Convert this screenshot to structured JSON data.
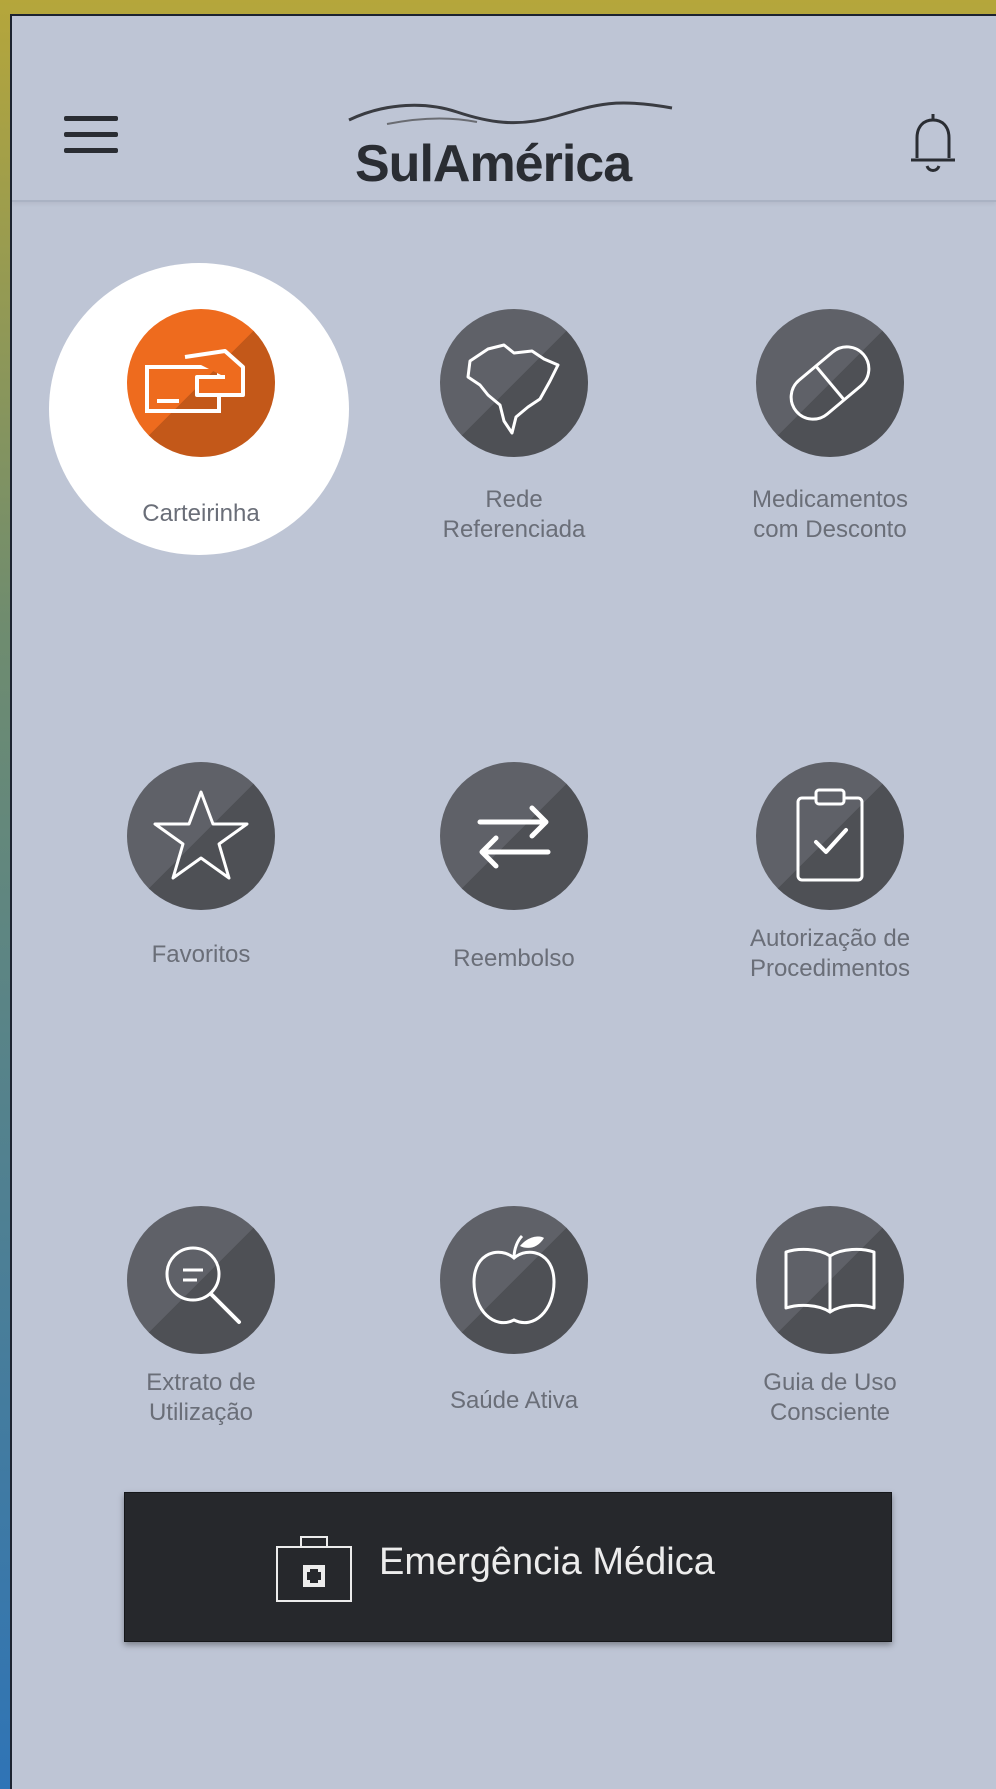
{
  "header": {
    "brand": "SulAmérica",
    "menu_icon": "hamburger-menu-icon",
    "bell_icon": "bell-icon"
  },
  "tiles": [
    {
      "label": "Carteirinha",
      "icon": "id-card-icon",
      "highlighted": true
    },
    {
      "label": "Rede\nReferenciada",
      "icon": "brazil-map-icon"
    },
    {
      "label": "Medicamentos\ncom Desconto",
      "icon": "pill-icon"
    },
    {
      "label": "Favoritos",
      "icon": "star-icon"
    },
    {
      "label": "Reembolso",
      "icon": "transfer-arrows-icon"
    },
    {
      "label": "Autorização de\nProcedimentos",
      "icon": "clipboard-check-icon"
    },
    {
      "label": "Extrato de\nUtilização",
      "icon": "magnifier-icon"
    },
    {
      "label": "Saúde Ativa",
      "icon": "apple-icon"
    },
    {
      "label": "Guia de Uso\nConsciente",
      "icon": "open-book-icon"
    }
  ],
  "emergency": {
    "label": "Emergência Médica",
    "icon": "first-aid-kit-icon"
  },
  "colors": {
    "background": "#bec5d5",
    "accent": "#ee6b1e",
    "icon_circle": "#5f6168",
    "emergency_bg": "#26282c"
  }
}
